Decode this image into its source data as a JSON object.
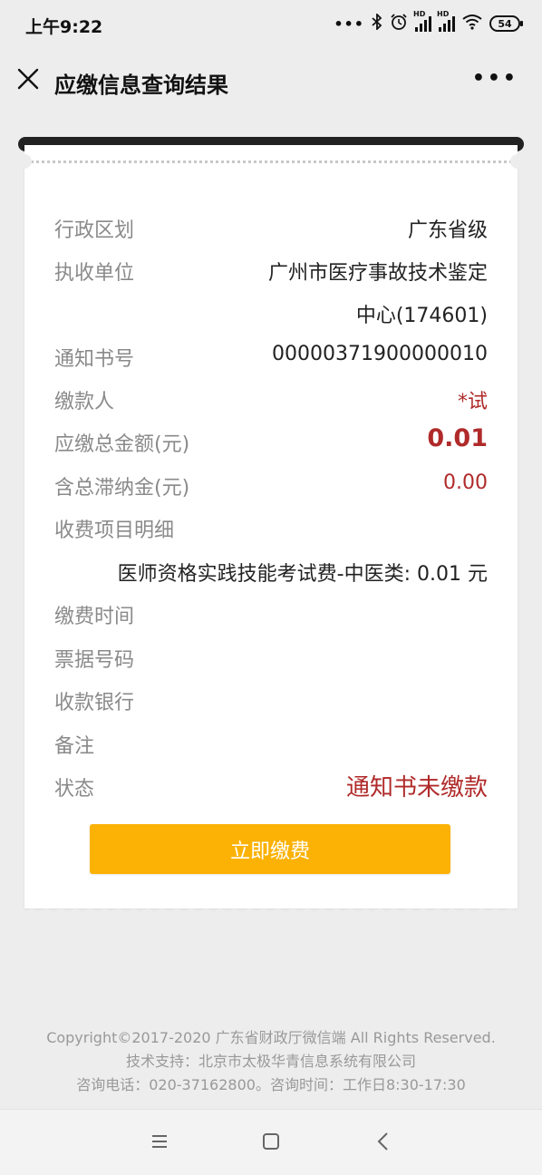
{
  "status_bar": {
    "time": "上午9:22",
    "battery": "54",
    "signal_label": "HD"
  },
  "header": {
    "title": "应缴信息查询结果"
  },
  "receipt": {
    "fields": [
      {
        "label": "行政区划",
        "value": "广东省级"
      },
      {
        "label": "执收单位",
        "value": "广州市医疗事故技术鉴定",
        "value_cont": "中心(174601)"
      },
      {
        "label": "通知书号",
        "value": "00000371900000010"
      },
      {
        "label": "缴款人",
        "value": "*试"
      },
      {
        "label": "应缴总金额(元)",
        "value": "0.01"
      },
      {
        "label": "含总滞纳金(元)",
        "value": "0.00"
      },
      {
        "label": "收费项目明细",
        "value": ""
      },
      {
        "label": "",
        "value": "医师资格实践技能考试费-中医类: 0.01 元"
      },
      {
        "label": "缴费时间",
        "value": ""
      },
      {
        "label": "票据号码",
        "value": ""
      },
      {
        "label": "收款银行",
        "value": ""
      },
      {
        "label": "备注",
        "value": ""
      },
      {
        "label": "状态",
        "value": "通知书未缴款"
      }
    ],
    "pay_button": "立即缴费"
  },
  "footer": {
    "copyright": "Copyright©2017-2020 广东省财政厅微信端 All Rights Reserved.",
    "support": "技术支持：北京市太极华青信息系统有限公司",
    "contact": "咨询电话：020-37162800。咨询时间：工作日8:30-17:30"
  },
  "colors": {
    "accent_red": "#b02a2a",
    "pay_button": "#fbb204",
    "background": "#ededed"
  },
  "icons": [
    "close-icon",
    "more-icon",
    "menu-icon",
    "home-icon",
    "back-icon",
    "bluetooth-icon",
    "alarm-icon",
    "wifi-icon"
  ]
}
